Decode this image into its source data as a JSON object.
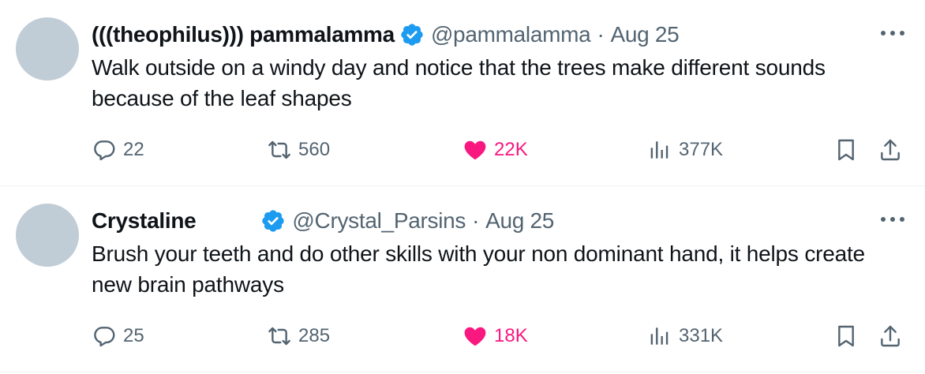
{
  "tweets": [
    {
      "display_name": "(((theophilus))) pammalamma",
      "handle": "@pammalamma",
      "separator": "·",
      "time": "Aug 25",
      "text": "Walk outside on a windy day and notice that the trees make different sounds because of the leaf shapes",
      "replies": "22",
      "reposts": "560",
      "likes": "22K",
      "views": "377K",
      "liked": true
    },
    {
      "display_name": "Crystaline",
      "handle": "@Crystal_Parsins",
      "separator": "·",
      "time": "Aug 25",
      "text": "Brush your teeth  and do other skills with your non dominant hand, it helps create new brain pathways",
      "replies": "25",
      "reposts": "285",
      "likes": "18K",
      "views": "331K",
      "liked": true
    }
  ],
  "colors": {
    "text": "#0f1419",
    "muted": "#536471",
    "like": "#f91880",
    "verified": "#1d9bf0",
    "avatar_placeholder": "#c0ccd6"
  },
  "icons": [
    "verified-badge-icon",
    "more-icon",
    "reply-icon",
    "repost-icon",
    "like-icon",
    "views-icon",
    "bookmark-icon",
    "share-icon"
  ]
}
